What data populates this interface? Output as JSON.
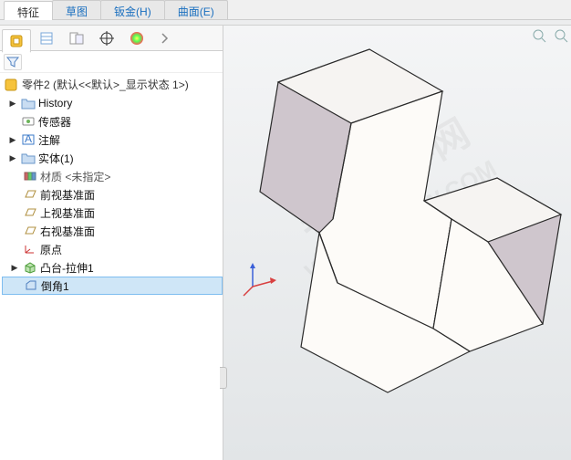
{
  "top_tabs": {
    "features": "特征",
    "sketch": "草图",
    "sheetmetal": "钣金(H)",
    "surface": "曲面(E)"
  },
  "part_root": "零件2 (默认<<默认>_显示状态 1>)",
  "tree": {
    "history": "History",
    "sensors": "传感器",
    "annotations": "注解",
    "bodies": "实体(1)",
    "material": "材质 <未指定>",
    "front": "前视基准面",
    "top": "上视基准面",
    "right": "右视基准面",
    "origin": "原点",
    "extrude": "凸台-拉伸1",
    "chamfer": "倒角1"
  },
  "icons": {
    "feature_tab": "feature-tree-icon",
    "property_tab": "property-manager-icon",
    "config_tab": "configuration-icon",
    "dim_tab": "dimxpert-icon",
    "appearance_tab": "appearance-icon"
  },
  "colors": {
    "selection": "#cfe6f7",
    "edge": "#2a2a2a",
    "face_light": "#f6f4f2",
    "face_shadow": "#cfc6cd"
  },
  "watermark_text": "软件自学网",
  "watermark_url": "WWW.RJZXW.COM"
}
